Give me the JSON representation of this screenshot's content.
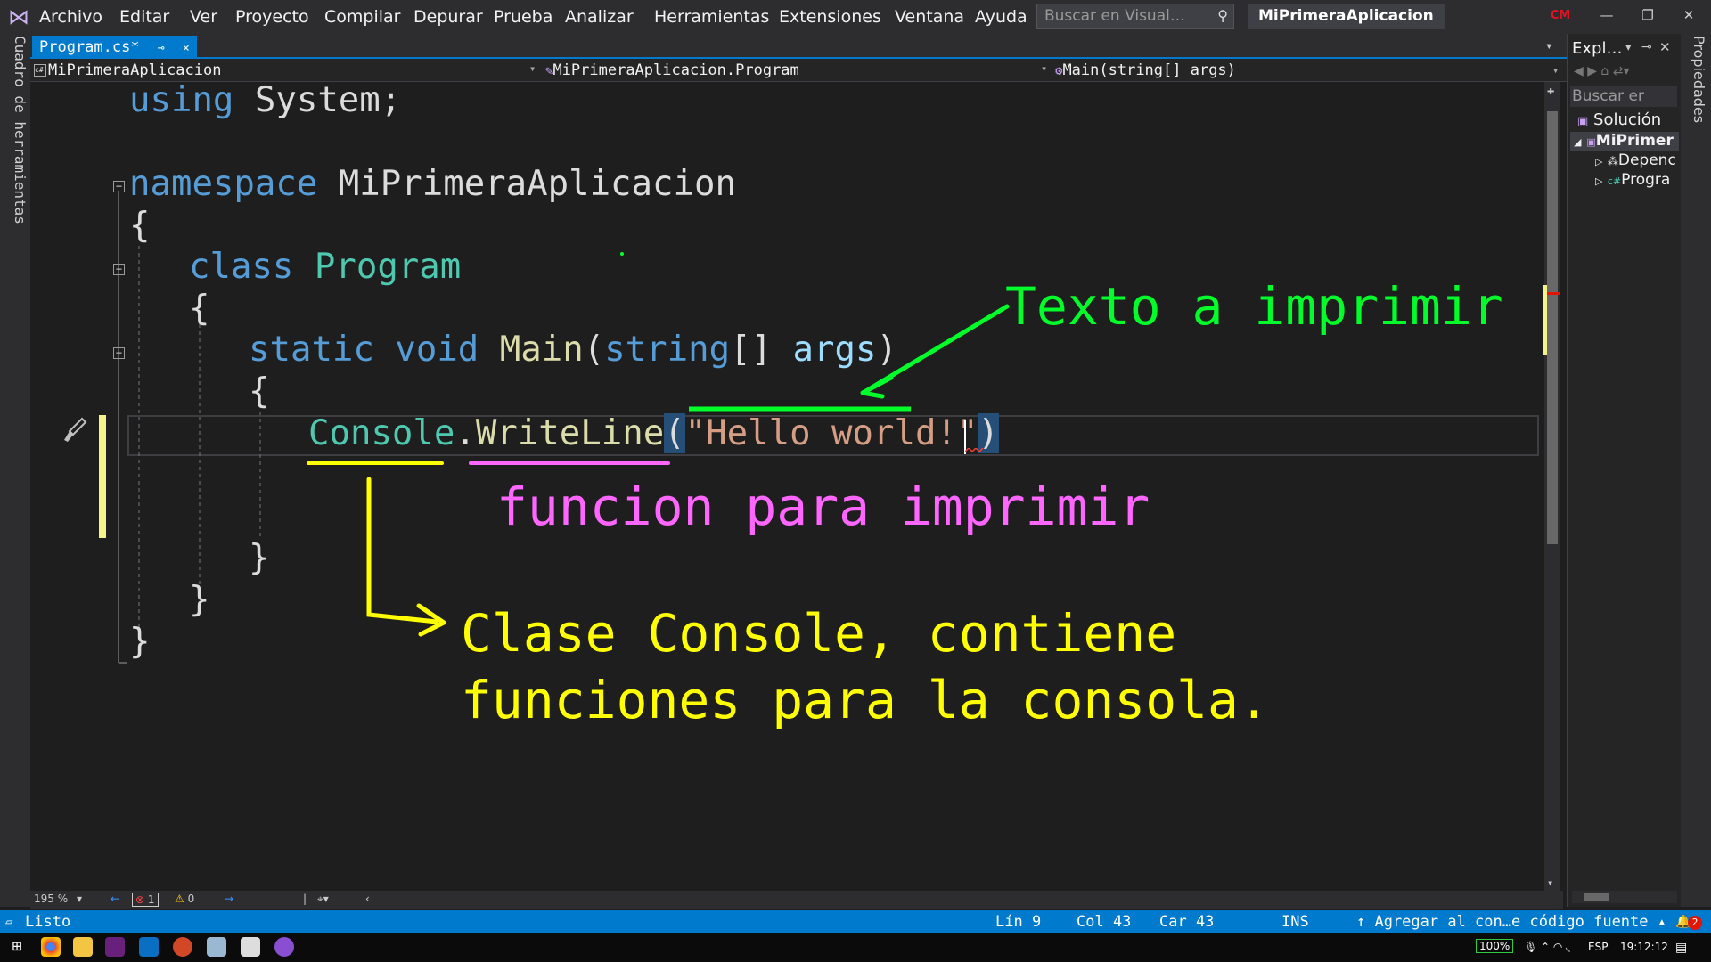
{
  "menu": {
    "items": [
      "Archivo",
      "Editar",
      "Ver",
      "Proyecto",
      "Compilar",
      "Depurar",
      "Prueba",
      "Analizar",
      "Herramientas",
      "Extensiones",
      "Ventana",
      "Ayuda"
    ],
    "search_placeholder": "Buscar en Visual…",
    "solution_title": "MiPrimeraAplicacion",
    "user_initials": "CM"
  },
  "left_strip": {
    "toolbox_label": "Cuadro de herramientas"
  },
  "tabs": [
    {
      "label": "Program.cs*",
      "pin": "⊸",
      "close": "×",
      "active": true
    }
  ],
  "nav_bar": {
    "project": "MiPrimeraAplicacion",
    "type": "MiPrimeraAplicacion.Program",
    "member": "Main(string[] args)"
  },
  "code": {
    "using_kw": "using",
    "using_ns": " System;",
    "namespace_kw": "namespace",
    "namespace_name": " MiPrimeraAplicacion",
    "open_brace": "{",
    "close_brace": "}",
    "class_kw": "class",
    "class_name": " Program",
    "static_kw": "static",
    "void_kw": " void",
    "main_name": " Main",
    "paren_open": "(",
    "string_kw": "string",
    "array_suffix": "[]",
    "args_name": " args",
    "paren_close": ")",
    "console": "Console",
    "dot": ".",
    "writeline": "WriteLine",
    "hello_str": "\"Hello world!\""
  },
  "annotations": {
    "green": "Texto a imprimir",
    "magenta": "funcion para imprimir",
    "yellow_line1": "Clase Console, contiene",
    "yellow_line2": "funciones para la consola.",
    "colors": {
      "green": "#00ff2a",
      "magenta": "#ff66ff",
      "yellow": "#ffff00"
    }
  },
  "editor_footer": {
    "zoom": "195 %",
    "errors": "1",
    "warnings": "0"
  },
  "solution_explorer": {
    "title": "Expl…",
    "search": "Buscar er",
    "items": [
      "Solución",
      "MiPrimer",
      "Depenc",
      "Progra"
    ]
  },
  "right_strip": {
    "properties_label": "Propiedades"
  },
  "status_bar": {
    "state": "Listo",
    "line": "Lín 9",
    "col": "Col 43",
    "char": "Car 43",
    "mode": "INS",
    "source_control": "↑ Agregar al con…e código fuente ▴",
    "notifications": "2"
  },
  "taskbar": {
    "battery": "100%",
    "lang": "ESP",
    "time": "19:12:12"
  }
}
